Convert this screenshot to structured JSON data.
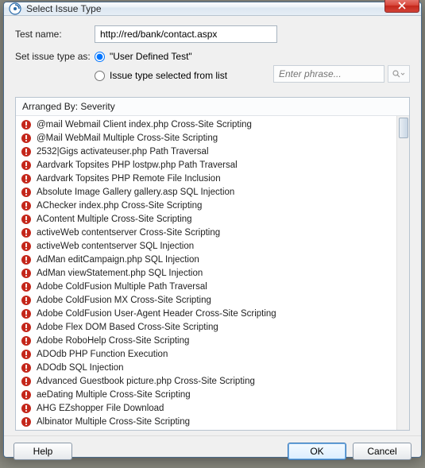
{
  "window": {
    "title": "Select Issue Type"
  },
  "form": {
    "test_name_label": "Test name:",
    "test_name_value": "http://red/bank/contact.aspx",
    "set_issue_label": "Set issue type as:",
    "radio_user_defined": "\"User Defined Test\"",
    "radio_from_list": "Issue type selected from list",
    "phrase_placeholder": "Enter phrase..."
  },
  "list": {
    "header": "Arranged By: Severity",
    "items": [
      "@mail Webmail Client index.php Cross-Site Scripting",
      "@Mail WebMail Multiple Cross-Site Scripting",
      "2532|Gigs activateuser.php Path Traversal",
      "Aardvark Topsites PHP lostpw.php Path Traversal",
      "Aardvark Topsites PHP Remote File Inclusion",
      "Absolute Image Gallery gallery.asp SQL Injection",
      "AChecker index.php Cross-Site Scripting",
      "AContent Multiple Cross-Site Scripting",
      "activeWeb contentserver Cross-Site Scripting",
      "activeWeb contentserver SQL Injection",
      "AdMan editCampaign.php SQL Injection",
      "AdMan viewStatement.php SQL Injection",
      "Adobe ColdFusion Multiple Path Traversal",
      "Adobe ColdFusion MX Cross-Site Scripting",
      "Adobe ColdFusion User-Agent Header Cross-Site Scripting",
      "Adobe Flex DOM Based Cross-Site Scripting",
      "Adobe RoboHelp Cross-Site Scripting",
      "ADOdb PHP Function Execution",
      "ADOdb SQL Injection",
      "Advanced Guestbook picture.php Cross-Site Scripting",
      "aeDating Multiple Cross-Site Scripting",
      "AHG EZshopper File Download",
      "Albinator Multiple Cross-Site Scripting"
    ]
  },
  "buttons": {
    "help": "Help",
    "ok": "OK",
    "cancel": "Cancel"
  }
}
